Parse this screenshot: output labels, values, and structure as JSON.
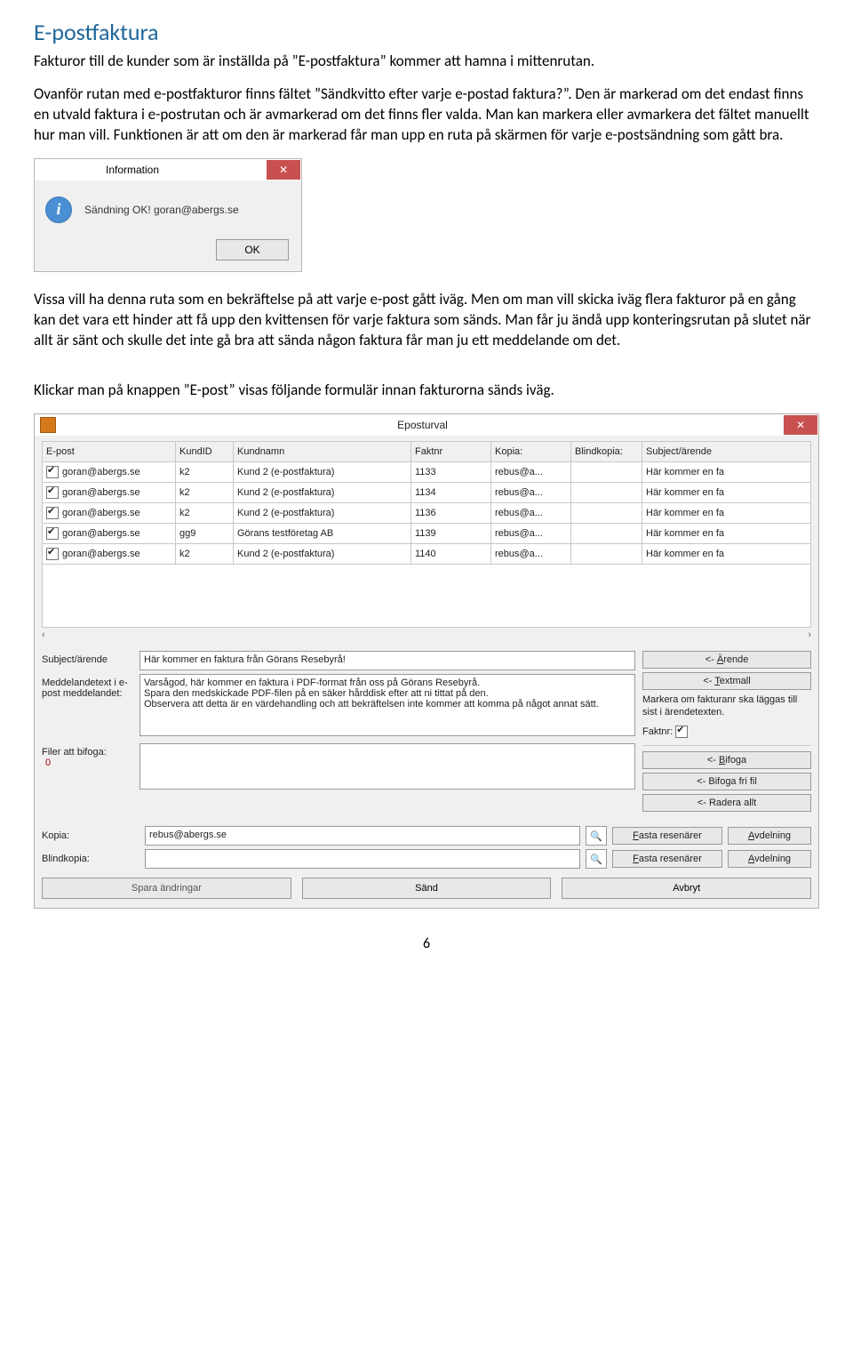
{
  "heading": "E-postfaktura",
  "para1": "Fakturor till de kunder som är inställda på ”E-postfaktura” kommer att hamna i mittenrutan.",
  "para2": "Ovanför rutan med e-postfakturor finns fältet ”Sändkvitto efter varje e-postad faktura?”. Den är markerad om det endast finns en utvald faktura i e-postrutan och är avmarkerad om det finns fler valda. Man kan markera eller avmarkera det fältet manuellt hur man vill. Funktionen är att om den är markerad får man upp en ruta på skärmen för varje e-postsändning som gått bra.",
  "dialog1": {
    "title": "Information",
    "message": "Sändning OK! goran@abergs.se",
    "ok": "OK"
  },
  "para3": "Vissa vill ha denna ruta som en bekräftelse på att varje e-post gått iväg. Men om man vill skicka iväg flera fakturor på en gång kan det vara ett hinder att få upp den kvittensen för varje faktura som sänds. Man får ju ändå upp konteringsrutan på slutet när allt är sänt och skulle det inte gå bra att sända någon faktura får man ju ett meddelande om det.",
  "para4": "Klickar man på knappen ”E-post” visas följande formulär innan fakturorna sänds iväg.",
  "eposturval": {
    "title": "Eposturval",
    "headers": {
      "epost": "E-post",
      "kundid": "KundID",
      "kundnamn": "Kundnamn",
      "faktnr": "Faktnr",
      "kopia": "Kopia:",
      "blind": "Blindkopia:",
      "subj": "Subject/ärende"
    },
    "rows": [
      {
        "epost": "goran@abergs.se",
        "kundid": "k2",
        "kundnamn": "Kund 2 (e-postfaktura)",
        "faktnr": "1133",
        "kopia": "rebus@a...",
        "blind": "",
        "subj": "Här kommer en fa"
      },
      {
        "epost": "goran@abergs.se",
        "kundid": "k2",
        "kundnamn": "Kund 2 (e-postfaktura)",
        "faktnr": "1134",
        "kopia": "rebus@a...",
        "blind": "",
        "subj": "Här kommer en fa"
      },
      {
        "epost": "goran@abergs.se",
        "kundid": "k2",
        "kundnamn": "Kund 2 (e-postfaktura)",
        "faktnr": "1136",
        "kopia": "rebus@a...",
        "blind": "",
        "subj": "Här kommer en fa"
      },
      {
        "epost": "goran@abergs.se",
        "kundid": "gg9",
        "kundnamn": "Görans testföretag AB",
        "faktnr": "1139",
        "kopia": "rebus@a...",
        "blind": "",
        "subj": "Här kommer en fa"
      },
      {
        "epost": "goran@abergs.se",
        "kundid": "k2",
        "kundnamn": "Kund 2 (e-postfaktura)",
        "faktnr": "1140",
        "kopia": "rebus@a...",
        "blind": "",
        "subj": "Här kommer en fa"
      }
    ],
    "labels": {
      "subject": "Subject/ärende",
      "msgtext": "Meddelandetext i e-post meddelandet:",
      "files": "Filer att bifoga:",
      "filecount": "0",
      "kopia": "Kopia:",
      "blind": "Blindkopia:"
    },
    "values": {
      "subject": "Här kommer en faktura från Görans Resebyrå!",
      "msgtext": "Varsågod, här kommer en faktura i PDF-format från oss på Görans Resebyrå.\nSpara den medskickade PDF-filen på en säker hårddisk efter att ni tittat på den.\nObservera att detta är en värdehandling och att bekräftelsen inte kommer att komma på något annat sätt.",
      "kopia": "rebus@abergs.se",
      "blind": ""
    },
    "buttons": {
      "arende": "<- Ärende",
      "textmall": "<- Textmall",
      "faknote": "Markera om fakturanr ska läggas till sist i ärendetexten.",
      "faktnr": "Faktnr:",
      "bifoga": "<- Bifoga",
      "bifogafri": "<- Bifoga fri fil",
      "radera": "<- Radera allt",
      "fastares": "Fasta resenärer",
      "avdelning": "Avdelning",
      "save": "Spara ändringar",
      "send": "Sänd",
      "cancel": "Avbryt"
    }
  },
  "pagenum": "6"
}
